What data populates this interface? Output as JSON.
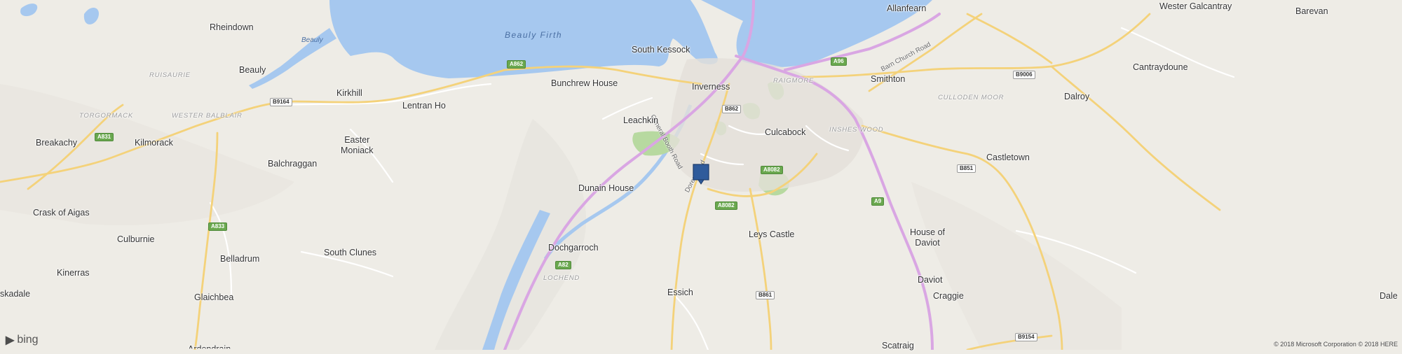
{
  "map": {
    "provider": "bing",
    "colors": {
      "land": "#eeece6",
      "water": "#a6c8ef",
      "motorway": "#d9a6e3",
      "major_road": "#f4d27a",
      "minor_road": "#ffffff",
      "park": "#b7d9a0",
      "urban": "#e3e0da",
      "pin": "#2f5b9b"
    },
    "places": [
      {
        "id": "rheindown",
        "name": "Rheindown"
      },
      {
        "id": "beauly",
        "name": "Beauly"
      },
      {
        "id": "kirkhill",
        "name": "Kirkhill"
      },
      {
        "id": "lentran-ho",
        "name": "Lentran Ho"
      },
      {
        "id": "bunchrew-house",
        "name": "Bunchrew House"
      },
      {
        "id": "south-kessock",
        "name": "South Kessock"
      },
      {
        "id": "inverness",
        "name": "Inverness"
      },
      {
        "id": "leachkin",
        "name": "Leachkin"
      },
      {
        "id": "culcabock",
        "name": "Culcabock"
      },
      {
        "id": "smithton",
        "name": "Smithton"
      },
      {
        "id": "allanfearn",
        "name": "Allanfearn"
      },
      {
        "id": "west-galcantray",
        "name": "Wester Galcantray"
      },
      {
        "id": "barevan",
        "name": "Barevan"
      },
      {
        "id": "cantraydoune",
        "name": "Cantraydoune"
      },
      {
        "id": "dalroy",
        "name": "Dalroy"
      },
      {
        "id": "breakachy",
        "name": "Breakachy"
      },
      {
        "id": "kilmorack",
        "name": "Kilmorack"
      },
      {
        "id": "easter-moniack-1",
        "name": "Easter"
      },
      {
        "id": "easter-moniack-2",
        "name": "Moniack"
      },
      {
        "id": "balchraggan",
        "name": "Balchraggan"
      },
      {
        "id": "dunain-house",
        "name": "Dunain House"
      },
      {
        "id": "castletown",
        "name": "Castletown"
      },
      {
        "id": "crask-of-aigas",
        "name": "Crask of Aigas"
      },
      {
        "id": "culburnie",
        "name": "Culburnie"
      },
      {
        "id": "leys-castle",
        "name": "Leys Castle"
      },
      {
        "id": "house-of-daviot-1",
        "name": "House of"
      },
      {
        "id": "house-of-daviot-2",
        "name": "Daviot"
      },
      {
        "id": "belladrum",
        "name": "Belladrum"
      },
      {
        "id": "south-clunes",
        "name": "South Clunes"
      },
      {
        "id": "dochgarroch",
        "name": "Dochgarroch"
      },
      {
        "id": "kinerras",
        "name": "Kinerras"
      },
      {
        "id": "daviot",
        "name": "Daviot"
      },
      {
        "id": "skadale",
        "name": "skadale"
      },
      {
        "id": "glaichbea",
        "name": "Glaichbea"
      },
      {
        "id": "essich",
        "name": "Essich"
      },
      {
        "id": "craggie",
        "name": "Craggie"
      },
      {
        "id": "dale",
        "name": "Dale"
      },
      {
        "id": "scatraig",
        "name": "Scatraig"
      },
      {
        "id": "ardendrain",
        "name": "Ardendrain"
      }
    ],
    "areas": [
      {
        "id": "ruisaurie",
        "name": "RUISAURIE"
      },
      {
        "id": "torgormack",
        "name": "TORGORMACK"
      },
      {
        "id": "wester-balblair",
        "name": "WESTER BALBLAIR"
      },
      {
        "id": "raigmore",
        "name": "RAIGMORE"
      },
      {
        "id": "culloden-moor",
        "name": "CULLODEN MOOR"
      },
      {
        "id": "inshes-wood",
        "name": "INSHES WOOD"
      },
      {
        "id": "lochend",
        "name": "LOCHEND"
      }
    ],
    "water_labels": [
      {
        "id": "beauly-firth",
        "name": "Beauly Firth"
      },
      {
        "id": "beauly-river",
        "name": "Beauly"
      }
    ],
    "streets": [
      {
        "id": "general-booth-road",
        "name": "General Booth Road"
      },
      {
        "id": "barn-church-road",
        "name": "Barn Church Road"
      },
      {
        "id": "dores-road",
        "name": "Dores Road"
      }
    ],
    "road_shields": [
      {
        "id": "a862-north",
        "label": "A862",
        "kind": "A"
      },
      {
        "id": "b9164",
        "label": "B9164",
        "kind": "B"
      },
      {
        "id": "a831",
        "label": "A831",
        "kind": "A"
      },
      {
        "id": "a833",
        "label": "A833",
        "kind": "A"
      },
      {
        "id": "b862",
        "label": "B862",
        "kind": "B"
      },
      {
        "id": "a8082-east",
        "label": "A8082",
        "kind": "A"
      },
      {
        "id": "a8082-south",
        "label": "A8082",
        "kind": "A"
      },
      {
        "id": "a96",
        "label": "A96",
        "kind": "A"
      },
      {
        "id": "b9006",
        "label": "B9006",
        "kind": "B"
      },
      {
        "id": "b851",
        "label": "B851",
        "kind": "B"
      },
      {
        "id": "a9",
        "label": "A9",
        "kind": "A"
      },
      {
        "id": "a82",
        "label": "A82",
        "kind": "A"
      },
      {
        "id": "b861",
        "label": "B861",
        "kind": "B"
      },
      {
        "id": "b9154",
        "label": "B9154",
        "kind": "B"
      }
    ],
    "attribution": {
      "logo_text": "bing",
      "copyright": "© 2018 Microsoft Corporation © 2018 HERE"
    }
  }
}
